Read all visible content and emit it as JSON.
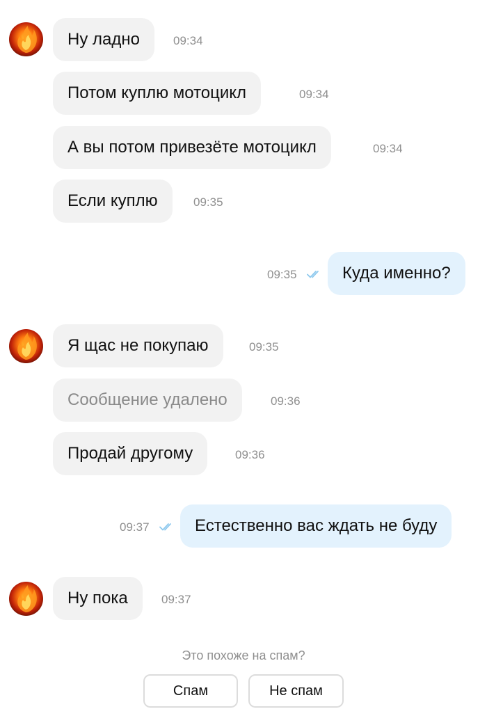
{
  "colors": {
    "incoming_bubble": "#f2f2f2",
    "outgoing_bubble": "#e3f2fd",
    "read_checks": "#8ec9ee",
    "timestamp": "#8f8f8f"
  },
  "messages": [
    {
      "direction": "incoming",
      "text": "Ну ладно",
      "time": "09:34"
    },
    {
      "direction": "incoming",
      "text": "Потом куплю мотоцикл",
      "time": "09:34"
    },
    {
      "direction": "incoming",
      "text": "А вы потом привезёте мотоцикл",
      "time": "09:34"
    },
    {
      "direction": "incoming",
      "text": "Если куплю",
      "time": "09:35"
    },
    {
      "direction": "outgoing",
      "text": "Куда именно?",
      "time": "09:35",
      "status": "read"
    },
    {
      "direction": "incoming",
      "text": "Я щас не покупаю",
      "time": "09:35"
    },
    {
      "direction": "incoming",
      "text": "Сообщение удалено",
      "time": "09:36",
      "deleted": true
    },
    {
      "direction": "incoming",
      "text": "Продай другому",
      "time": "09:36"
    },
    {
      "direction": "outgoing",
      "text": "Естественно вас ждать не буду",
      "time": "09:37",
      "status": "read"
    },
    {
      "direction": "incoming",
      "text": "Ну пока",
      "time": "09:37"
    }
  ],
  "spam_prompt": {
    "question": "Это похоже на спам?",
    "spam_label": "Спам",
    "not_spam_label": "Не спам"
  }
}
